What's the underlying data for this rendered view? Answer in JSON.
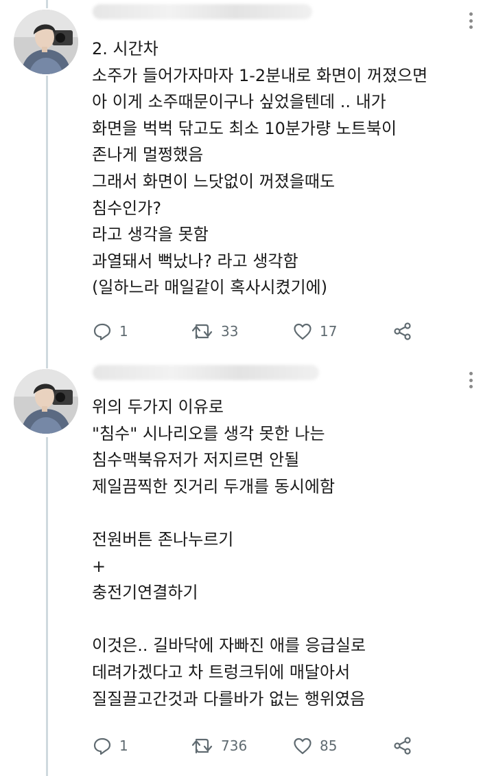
{
  "tweets": [
    {
      "lines": [
        "2. 시간차",
        "소주가 들어가자마자 1-2분내로 화면이 꺼졌으면",
        "아 이게 소주때문이구나 싶었을텐데 .. 내가",
        "화면을 벅벅 닦고도 최소 10분가량 노트북이",
        "존나게 멀쩡했음",
        "그래서 화면이 느닷없이 꺼졌을때도",
        "침수인가?",
        "라고 생각을 못함",
        "과열돼서 뻑났나? 라고 생각함",
        "(일하느라 매일같이 혹사시켰기에)"
      ],
      "reply_count": "1",
      "retweet_count": "33",
      "like_count": "17"
    },
    {
      "lines": [
        "위의 두가지 이유로",
        "\"침수\" 시나리오를 생각 못한 나는",
        "침수맥북유저가 저지르면 안될",
        "제일끔찍한 짓거리 두개를 동시에함",
        "",
        "전원버튼 존나누르기",
        "+",
        "충전기연결하기",
        "",
        "이것은.. 길바닥에 자빠진 애를 응급실로",
        "데려가겠다고 차 트렁크뒤에 매달아서",
        "질질끌고간것과 다를바가 없는 행위였음"
      ],
      "reply_count": "1",
      "retweet_count": "736",
      "like_count": "85"
    }
  ],
  "icons": {
    "more": "more-icon",
    "reply": "reply-icon",
    "retweet": "retweet-icon",
    "like": "like-icon",
    "share": "share-icon"
  },
  "colors": {
    "text": "#1a1a1a",
    "meta": "#5f6a70",
    "thread_line": "#cfd9de",
    "background": "#ffffff"
  }
}
